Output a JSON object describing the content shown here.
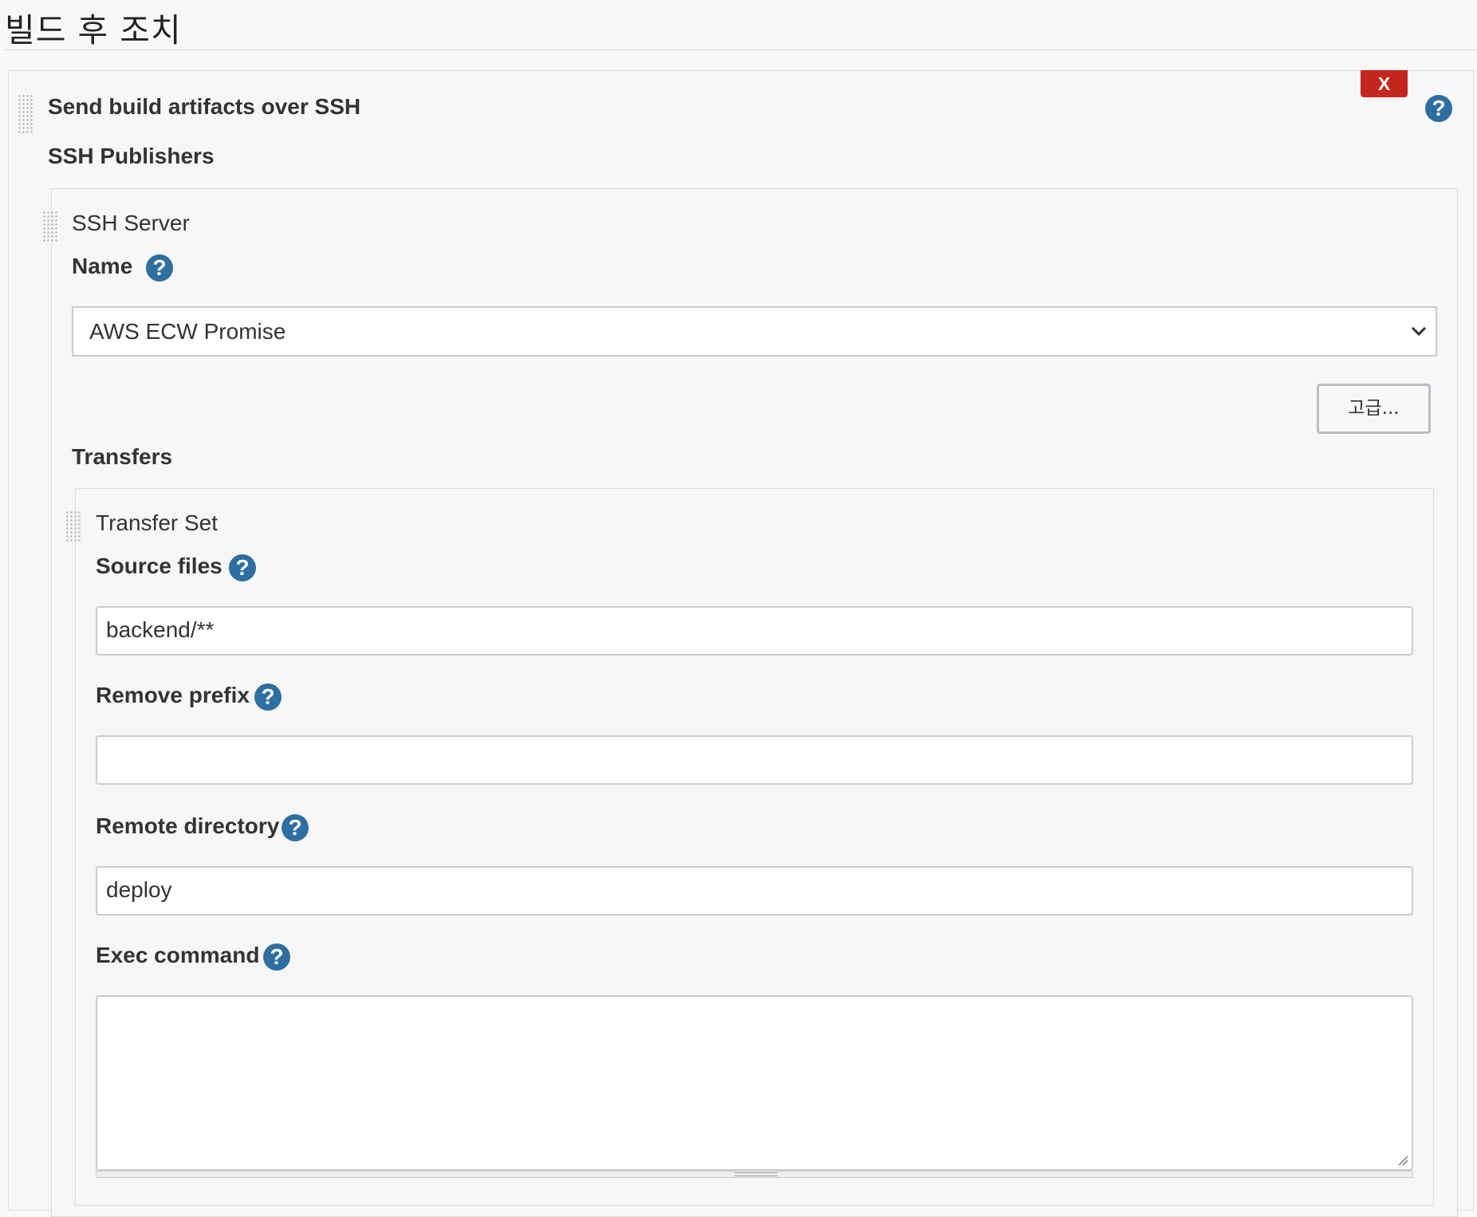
{
  "section": {
    "title": "빌드 후 조치"
  },
  "plugin": {
    "title": "Send build artifacts over SSH",
    "delete_label": "X",
    "help_glyph": "?",
    "publishers_label": "SSH Publishers"
  },
  "server": {
    "heading": "SSH Server",
    "name_label": "Name",
    "name_value": "AWS ECW Promise",
    "advanced_label": "고급..."
  },
  "transfers": {
    "label": "Transfers",
    "set_heading": "Transfer Set",
    "fields": {
      "source_files": {
        "label": "Source files",
        "value": "backend/**"
      },
      "remove_prefix": {
        "label": "Remove prefix",
        "value": ""
      },
      "remote_directory": {
        "label": "Remote directory",
        "value": "deploy"
      },
      "exec_command": {
        "label": "Exec command",
        "value": ""
      }
    }
  },
  "icons": {
    "help": "help-icon",
    "dropdown": "chevron-down-icon",
    "drag": "drag-handle-icon",
    "resize": "resize-handle-icon"
  },
  "colors": {
    "delete_button": "#c4261d",
    "help_icon": "#2e6ea0",
    "background": "#f8f8f8"
  }
}
